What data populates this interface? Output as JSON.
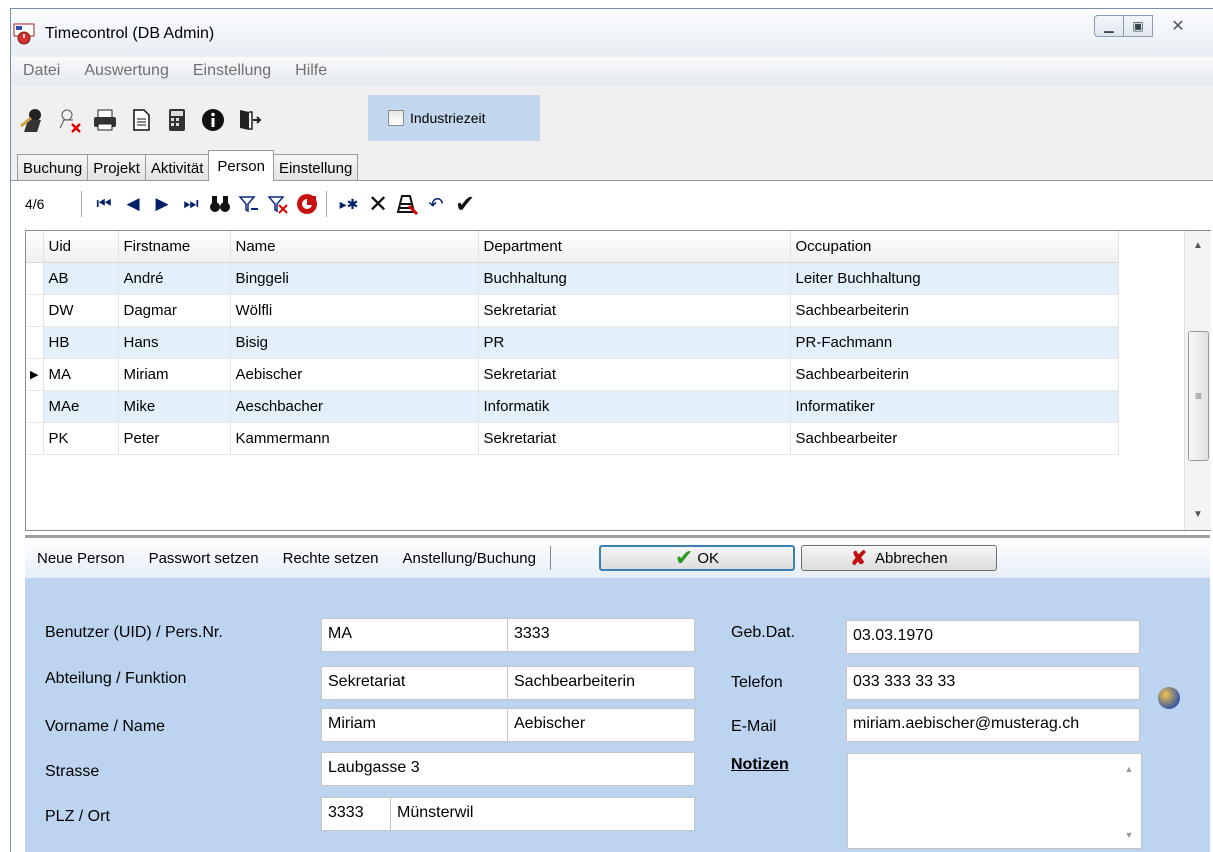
{
  "window": {
    "title": "Timecontrol (DB Admin)"
  },
  "menu": [
    "Datei",
    "Auswertung",
    "Einstellung",
    "Hilfe"
  ],
  "toolbar": {
    "icons": [
      "user-edit-icon",
      "user-delete-icon",
      "printer-icon",
      "document-icon",
      "calculator-icon",
      "info-icon",
      "exit-door-icon"
    ],
    "industriezeit_label": "Industriezeit",
    "industriezeit_checked": false
  },
  "tabs": [
    "Buchung",
    "Projekt",
    "Aktivität",
    "Person",
    "Einstellung"
  ],
  "active_tab": "Person",
  "navigator": {
    "position": "4/6"
  },
  "grid": {
    "columns": [
      "Uid",
      "Firstname",
      "Name",
      "Department",
      "Occupation"
    ],
    "rows": [
      [
        "AB",
        "André",
        "Binggeli",
        "Buchhaltung",
        "Leiter Buchhaltung"
      ],
      [
        "DW",
        "Dagmar",
        "Wölfli",
        "Sekretariat",
        "Sachbearbeiterin"
      ],
      [
        "HB",
        "Hans",
        "Bisig",
        "PR",
        "PR-Fachmann"
      ],
      [
        "MA",
        "Miriam",
        "Aebischer",
        "Sekretariat",
        "Sachbearbeiterin"
      ],
      [
        "MAe",
        "Mike",
        "Aeschbacher",
        "Informatik",
        "Informatiker"
      ],
      [
        "PK",
        "Peter",
        "Kammermann",
        "Sekretariat",
        "Sachbearbeiter"
      ]
    ],
    "current_row": 4
  },
  "actions": {
    "new_person": "Neue Person",
    "set_password": "Passwort setzen",
    "set_rights": "Rechte setzen",
    "employment": "Anstellung/Buchung",
    "ok": "OK",
    "cancel": "Abbrechen"
  },
  "form": {
    "labels": {
      "uid": "Benutzer (UID)  / Pers.Nr.",
      "dept": "Abteilung / Funktion",
      "name": "Vorname / Name",
      "street": "Strasse",
      "city": "PLZ / Ort",
      "birth": "Geb.Dat.",
      "phone": "Telefon",
      "email": "E-Mail",
      "notes": "Notizen"
    },
    "values": {
      "uid": "MA",
      "pers_nr": "3333",
      "department": "Sekretariat",
      "function": "Sachbearbeiterin",
      "firstname": "Miriam",
      "lastname": "Aebischer",
      "street": "Laubgasse 3",
      "zip": "3333",
      "city": "Münsterwil",
      "birthdate": "03.03.1970",
      "phone": "033 333 33 33",
      "email": "miriam.aebischer@musterag.ch"
    }
  }
}
